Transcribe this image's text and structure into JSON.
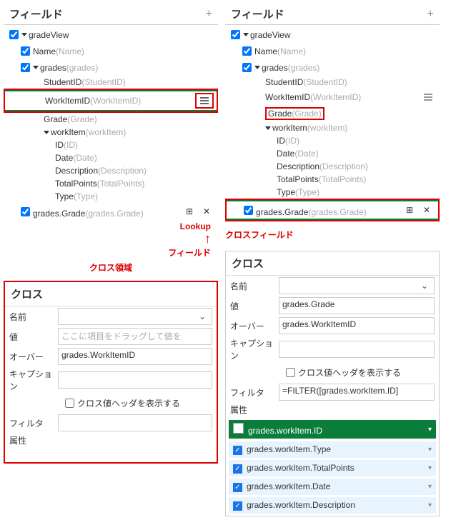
{
  "left": {
    "fieldsHeader": "フィールド",
    "root": "gradeView",
    "name": "Name",
    "nameGray": "(Name)",
    "grades": "grades",
    "gradesGray": "(grades)",
    "studentId": "StudentID",
    "studentIdGray": "(StudentID)",
    "workItemId": "WorkItemID",
    "workItemIdGray": "(WorkItemID)",
    "grade": "Grade",
    "gradeGray": "(Grade)",
    "workItem": "workItem",
    "workItemGray": "(workItem)",
    "id": "ID",
    "idGray": "(ID)",
    "date": "Date",
    "dateGray": "(Date)",
    "desc": "Description",
    "descGray": "(Description)",
    "tp": "TotalPoints",
    "tpGray": "(TotalPoints)",
    "type": "Type",
    "typeGray": "(Type)",
    "gradesGrade": "grades.Grade",
    "gradesGradeGray": "(grades.Grade)",
    "lookupNote": "Lookup",
    "fieldNote": "フィールド",
    "crossArea": "クロス領域",
    "crossHeader": "クロス",
    "form": {
      "name": "名前",
      "value": "値",
      "valuePh": "ここに項目をドラッグして値を",
      "over": "オーバー",
      "overVal": "grades.WorkItemID",
      "caption": "キャプション",
      "showHeader": "クロス値ヘッダを表示する",
      "filter": "フィルタ",
      "attrs": "属性"
    }
  },
  "right": {
    "fieldsHeader": "フィールド",
    "crossField": "クロスフィールド",
    "crossHeader": "クロス",
    "form": {
      "name": "名前",
      "value": "値",
      "valueVal": "grades.Grade",
      "over": "オーバー",
      "overVal": "grades.WorkItemID",
      "caption": "キャプション",
      "showHeader": "クロス値ヘッダを表示する",
      "filter": "フィルタ",
      "filterVal": "=FILTER([grades.workItem.ID]",
      "attrs": "属性"
    },
    "attrs": [
      "grades.workItem.ID",
      "grades.workItem.Type",
      "grades.workItem.TotalPoints",
      "grades.workItem.Date",
      "grades.workItem.Description"
    ]
  }
}
